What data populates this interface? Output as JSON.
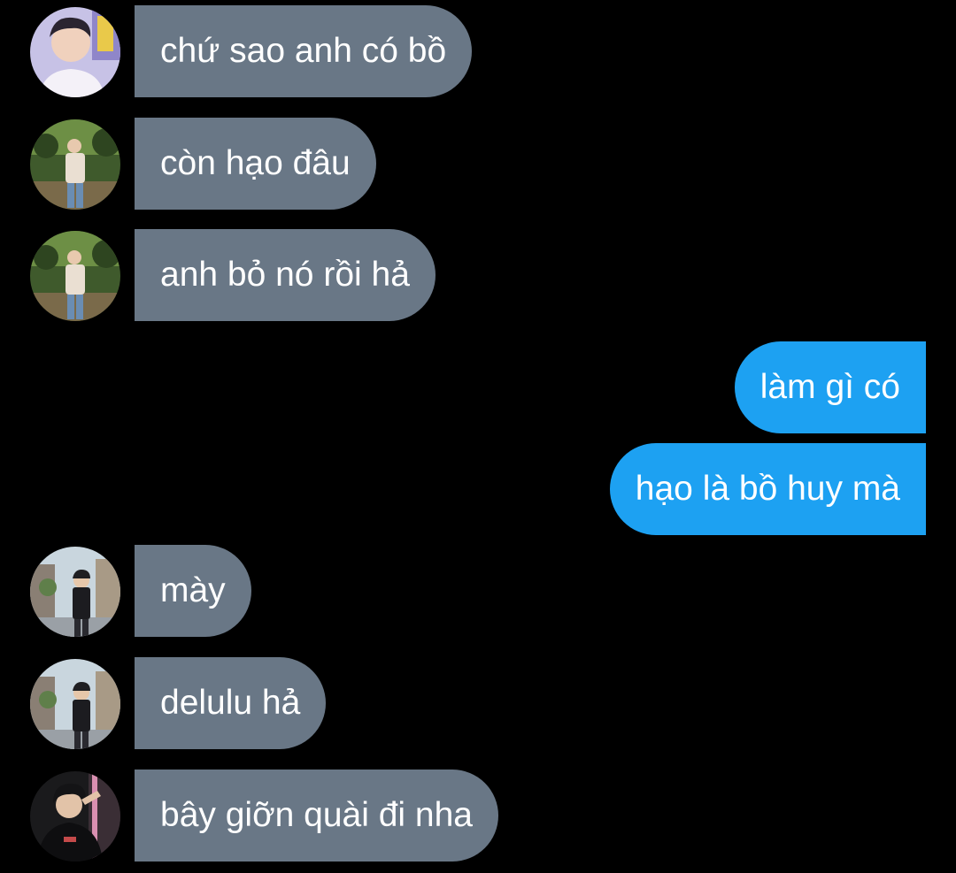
{
  "conversation": {
    "messages": [
      {
        "sender": "other",
        "avatar": "portrait-boy-smiling",
        "text": "chứ sao anh có bồ"
      },
      {
        "sender": "other",
        "avatar": "portrait-boy-in-park",
        "text": "còn hạo đâu"
      },
      {
        "sender": "other",
        "avatar": "portrait-boy-in-park",
        "text": "anh bỏ nó rồi hả"
      },
      {
        "sender": "me",
        "text": "làm gì có"
      },
      {
        "sender": "me",
        "text": "hạo là bồ huy mà"
      },
      {
        "sender": "other",
        "avatar": "portrait-boy-on-street",
        "text": "mày"
      },
      {
        "sender": "other",
        "avatar": "portrait-boy-on-street",
        "text": "delulu hả"
      },
      {
        "sender": "other",
        "avatar": "portrait-boy-black-shirt",
        "text": "bây giỡn quài đi nha"
      }
    ]
  },
  "colors": {
    "background": "#000000",
    "incoming_bubble": "#697786",
    "outgoing_bubble": "#1da1f2",
    "text": "#ffffff"
  }
}
